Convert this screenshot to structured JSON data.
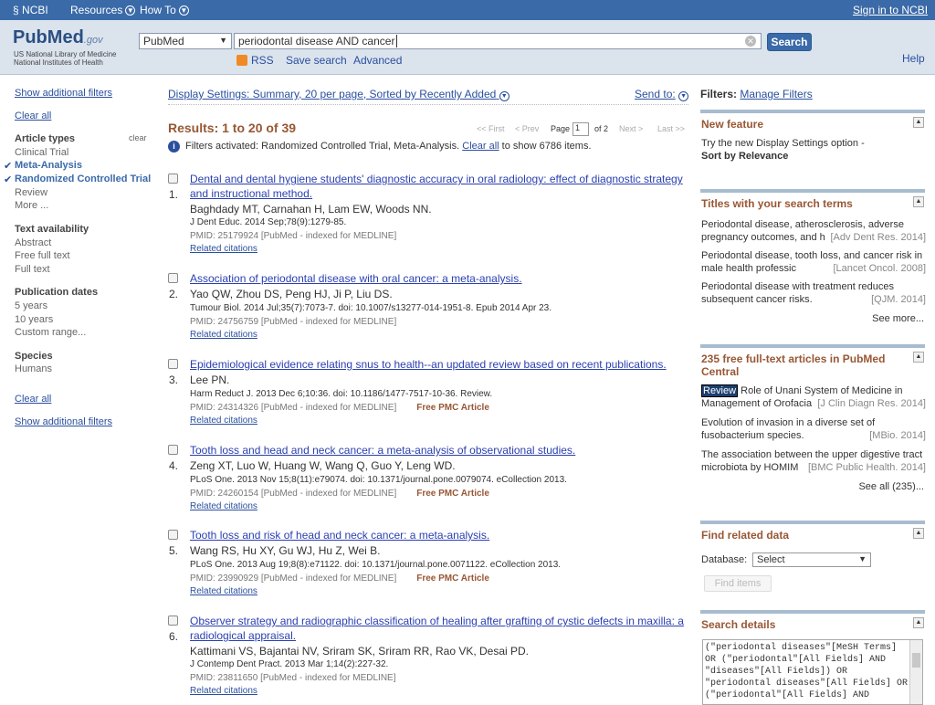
{
  "topbar": {
    "ncbi": "NCBI",
    "resources": "Resources",
    "howto": "How To",
    "signin": "Sign in to NCBI"
  },
  "header": {
    "logo_pub": "Pub",
    "logo_med": "Med",
    "logo_gov": ".gov",
    "nlm": "US National Library of Medicine National Institutes of Health",
    "db_value": "PubMed",
    "search_value": "periodontal disease AND cancer",
    "search_btn": "Search",
    "rss": "RSS",
    "save_search": "Save search",
    "advanced": "Advanced",
    "help": "Help"
  },
  "left": {
    "show_filters_top": "Show additional filters",
    "clear_all_top": "Clear all",
    "article_types": "Article types",
    "clear": "clear",
    "clinical_trial": "Clinical Trial",
    "meta_analysis": "Meta-Analysis",
    "rct": "Randomized Controlled Trial",
    "review": "Review",
    "more": "More ...",
    "text_avail": "Text availability",
    "abstract": "Abstract",
    "free_full": "Free full text",
    "full_text": "Full text",
    "pub_dates": "Publication dates",
    "five_years": "5 years",
    "ten_years": "10 years",
    "custom_range": "Custom range...",
    "species": "Species",
    "humans": "Humans",
    "clear_all_bottom": "Clear all",
    "show_filters_bottom": "Show additional filters"
  },
  "center": {
    "display_settings": "Display Settings: Summary, 20 per page, Sorted by Recently Added",
    "send_to": "Send to:",
    "results_title": "Results: 1 to 20 of 39",
    "pager": {
      "first": "<< First",
      "prev": "< Prev",
      "page": "Page",
      "page_value": "1",
      "of": "of 2",
      "next": "Next >",
      "last": "Last >>"
    },
    "filter_note": "Filters activated: Randomized Controlled Trial, Meta-Analysis.",
    "clear_all": "Clear all",
    "filter_note_tail": "to show 6786 items.",
    "results": [
      {
        "num": "1.",
        "title": "Dental and dental hygiene students' diagnostic accuracy in oral radiology: effect of diagnostic strategy and instructional method.",
        "authors": "Baghdady MT, Carnahan H, Lam EW, Woods NN.",
        "source": "J Dent Educ. 2014 Sep;78(9):1279-85.",
        "pmid": "PMID: 25179924 [PubMed - indexed for MEDLINE]",
        "pmc": "",
        "related": "Related citations"
      },
      {
        "num": "2.",
        "title": "Association of periodontal disease with oral cancer: a meta-analysis.",
        "authors": "Yao QW, Zhou DS, Peng HJ, Ji P, Liu DS.",
        "source": "Tumour Biol. 2014 Jul;35(7):7073-7. doi: 10.1007/s13277-014-1951-8. Epub 2014 Apr 23.",
        "pmid": "PMID: 24756759 [PubMed - indexed for MEDLINE]",
        "pmc": "",
        "related": "Related citations"
      },
      {
        "num": "3.",
        "title": "Epidemiological evidence relating snus to health--an updated review based on recent publications.",
        "authors": "Lee PN.",
        "source": "Harm Reduct J. 2013 Dec 6;10:36. doi: 10.1186/1477-7517-10-36. Review.",
        "pmid": "PMID: 24314326 [PubMed - indexed for MEDLINE]",
        "pmc": "Free PMC Article",
        "related": "Related citations"
      },
      {
        "num": "4.",
        "title": "Tooth loss and head and neck cancer: a meta-analysis of observational studies.",
        "authors": "Zeng XT, Luo W, Huang W, Wang Q, Guo Y, Leng WD.",
        "source": "PLoS One. 2013 Nov 15;8(11):e79074. doi: 10.1371/journal.pone.0079074. eCollection 2013.",
        "pmid": "PMID: 24260154 [PubMed - indexed for MEDLINE]",
        "pmc": "Free PMC Article",
        "related": "Related citations"
      },
      {
        "num": "5.",
        "title": "Tooth loss and risk of head and neck cancer: a meta-analysis.",
        "authors": "Wang RS, Hu XY, Gu WJ, Hu Z, Wei B.",
        "source": "PLoS One. 2013 Aug 19;8(8):e71122. doi: 10.1371/journal.pone.0071122. eCollection 2013.",
        "pmid": "PMID: 23990929 [PubMed - indexed for MEDLINE]",
        "pmc": "Free PMC Article",
        "related": "Related citations"
      },
      {
        "num": "6.",
        "title": "Observer strategy and radiographic classification of healing after grafting of cystic defects in maxilla: a radiological appraisal.",
        "authors": "Kattimani VS, Bajantai NV, Sriram SK, Sriram RR, Rao VK, Desai PD.",
        "source": "J Contemp Dent Pract. 2013 Mar 1;14(2):227-32.",
        "pmid": "PMID: 23811650 [PubMed - indexed for MEDLINE]",
        "pmc": "",
        "related": "Related citations"
      }
    ]
  },
  "right": {
    "filters_label": "Filters:",
    "manage_filters": "Manage Filters",
    "new_feature": {
      "title": "New feature",
      "text": "Try the new Display Settings option -",
      "bold": "Sort by Relevance"
    },
    "titles": {
      "title": "Titles with your search terms",
      "items": [
        {
          "text": "Periodontal disease, atherosclerosis, adverse pregnancy outcomes, and h",
          "journal": "[Adv Dent Res. 2014]"
        },
        {
          "text": "Periodontal disease, tooth loss, and cancer risk in male health professic",
          "journal": "[Lancet Oncol. 2008]"
        },
        {
          "text": "Periodontal disease with treatment reduces subsequent cancer risks.",
          "journal": "[QJM. 2014]"
        }
      ],
      "see_more": "See more..."
    },
    "free": {
      "title": "235 free full-text articles in PubMed Central",
      "items": [
        {
          "badge": "Review",
          "text": "Role of Unani System of Medicine in Management of Orofacia",
          "journal": "[J Clin Diagn Res. 2014]"
        },
        {
          "text": "Evolution of invasion in a diverse set of fusobacterium species.",
          "journal": "[MBio. 2014]"
        },
        {
          "text": "The association between the upper digestive tract microbiota by HOMIM",
          "journal": "[BMC Public Health. 2014]"
        }
      ],
      "see_all": "See all (235)..."
    },
    "related": {
      "title": "Find related data",
      "db_label": "Database:",
      "db_value": "Select",
      "find_btn": "Find items"
    },
    "details": {
      "title": "Search details",
      "query": "(\"periodontal diseases\"[MeSH Terms]\nOR (\"periodontal\"[All Fields] AND\n\"diseases\"[All Fields]) OR\n\"periodontal diseases\"[All Fields] OR\n(\"periodontal\"[All Fields] AND"
    }
  },
  "colors": {
    "brand": "#3a6aa8",
    "result_link": "#2a3fb0",
    "accent": "#985735"
  }
}
